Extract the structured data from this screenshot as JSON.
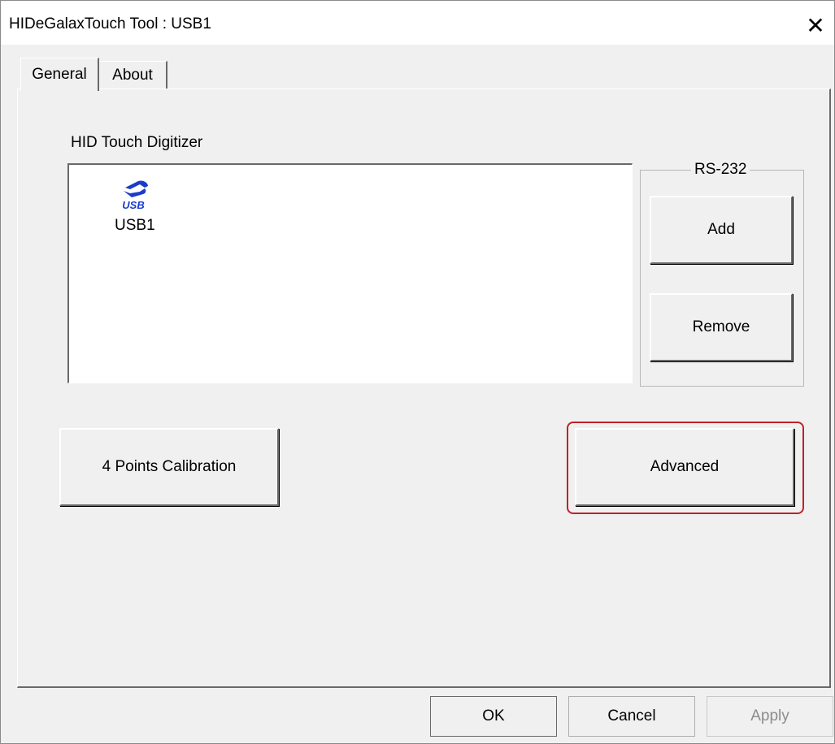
{
  "window": {
    "title": "HIDeGalaxTouch Tool : USB1",
    "close_glyph": "✕"
  },
  "tabs": [
    {
      "label": "General",
      "selected": true
    },
    {
      "label": "About",
      "selected": false
    }
  ],
  "general": {
    "section_label": "HID Touch Digitizer",
    "devices": [
      {
        "icon": "usb-icon",
        "icon_text": "USB",
        "label": "USB1"
      }
    ],
    "rs232": {
      "title": "RS-232",
      "add_label": "Add",
      "remove_label": "Remove"
    },
    "calibration_label": "4 Points Calibration",
    "advanced_label": "Advanced"
  },
  "footer": {
    "ok_label": "OK",
    "cancel_label": "Cancel",
    "apply_label": "Apply",
    "apply_enabled": false
  },
  "colors": {
    "highlight": "#c0202a",
    "usb_logo": "#1a3cc8"
  }
}
